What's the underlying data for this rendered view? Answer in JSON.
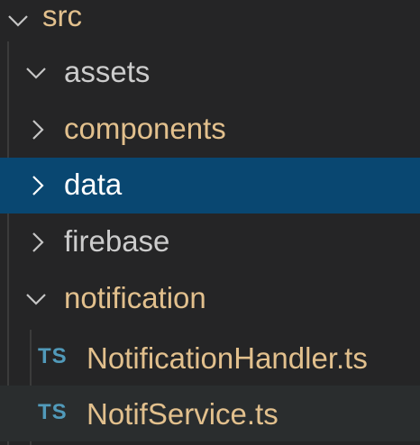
{
  "explorer": {
    "colors": {
      "background": "#252526",
      "selected_row": "#094771",
      "hover_row": "#2a2d2e",
      "modified_folder_text": "#e2c08d",
      "default_text": "#cccccc",
      "selected_text": "#ffffff",
      "ts_icon": "#519aba",
      "chevron": "#c5c5c5"
    },
    "items": [
      {
        "label": "src",
        "kind": "folder",
        "expanded": true,
        "icon": "chevron-down-icon"
      },
      {
        "label": "assets",
        "kind": "folder",
        "expanded": true,
        "icon": "chevron-down-icon"
      },
      {
        "label": "components",
        "kind": "folder",
        "expanded": false,
        "icon": "chevron-right-icon"
      },
      {
        "label": "data",
        "kind": "folder",
        "expanded": false,
        "selected": true,
        "icon": "chevron-right-icon"
      },
      {
        "label": "firebase",
        "kind": "folder",
        "expanded": false,
        "icon": "chevron-right-icon"
      },
      {
        "label": "notification",
        "kind": "folder",
        "expanded": true,
        "icon": "chevron-down-icon"
      },
      {
        "label": "NotificationHandler.ts",
        "kind": "file",
        "badge": "TS",
        "icon": "typescript-file-icon"
      },
      {
        "label": "NotifService.ts",
        "kind": "file",
        "badge": "TS",
        "icon": "typescript-file-icon"
      }
    ]
  }
}
